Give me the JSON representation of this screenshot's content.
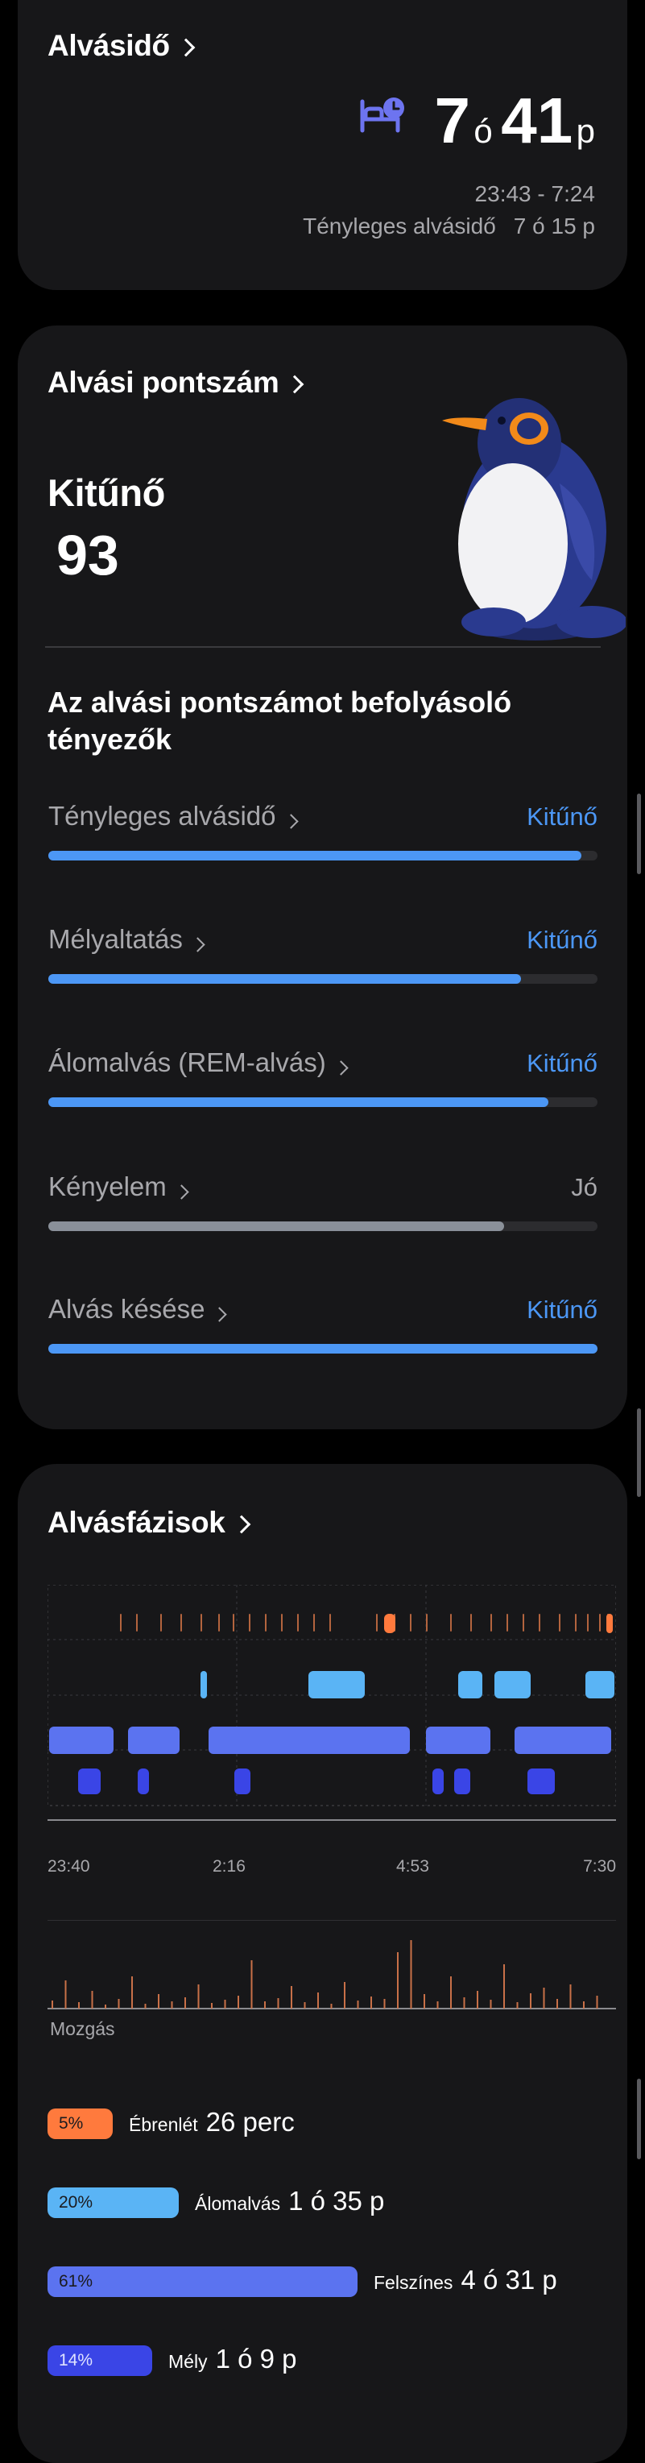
{
  "sleep_time": {
    "title": "Alvásidő",
    "hours": "7",
    "hours_unit": "ó",
    "minutes": "41",
    "minutes_unit": "p",
    "range": "23:43 - 7:24",
    "actual_label": "Tényleges alvásidő",
    "actual_value": "7 ó 15 p"
  },
  "sleep_score": {
    "title": "Alvási pontszám",
    "rating": "Kitűnő",
    "score": "93",
    "factors_title": "Az alvási pontszámot befolyásoló tényezők",
    "factors": [
      {
        "label": "Tényleges alvásidő",
        "value": "Kitűnő",
        "level": 0.97,
        "color": "#4c97f5"
      },
      {
        "label": "Mélyaltatás",
        "value": "Kitűnő",
        "level": 0.86,
        "color": "#4c97f5"
      },
      {
        "label": "Álomalvás (REM-alvás)",
        "value": "Kitűnő",
        "level": 0.91,
        "color": "#4c97f5"
      },
      {
        "label": "Kényelem",
        "value": "Jó",
        "level": 0.83,
        "color": "#8a9099"
      },
      {
        "label": "Alvás késése",
        "value": "Kitűnő",
        "level": 1.0,
        "color": "#4c97f5"
      }
    ]
  },
  "sleep_stages": {
    "title": "Alvásfázisok",
    "time_ticks": [
      "23:40",
      "2:16",
      "4:53",
      "7:30"
    ],
    "movement_label": "Mozgás",
    "colors": {
      "awake": "#ff7a3d",
      "rem": "#5ab4f5",
      "light": "#5b73f0",
      "deep": "#3a45e6"
    },
    "legend": [
      {
        "key": "awake",
        "percent": "5%",
        "label": "Ébrenlét",
        "value": "26 perc",
        "share": 0.05
      },
      {
        "key": "rem",
        "percent": "20%",
        "label": "Álomalvás",
        "value": "1 ó 35 p",
        "share": 0.2
      },
      {
        "key": "light",
        "percent": "61%",
        "label": "Felszínes",
        "value": "4 ó 31 p",
        "share": 0.61
      },
      {
        "key": "deep",
        "percent": "14%",
        "label": "Mély",
        "value": "1 ó 9 p",
        "share": 0.14
      }
    ]
  }
}
